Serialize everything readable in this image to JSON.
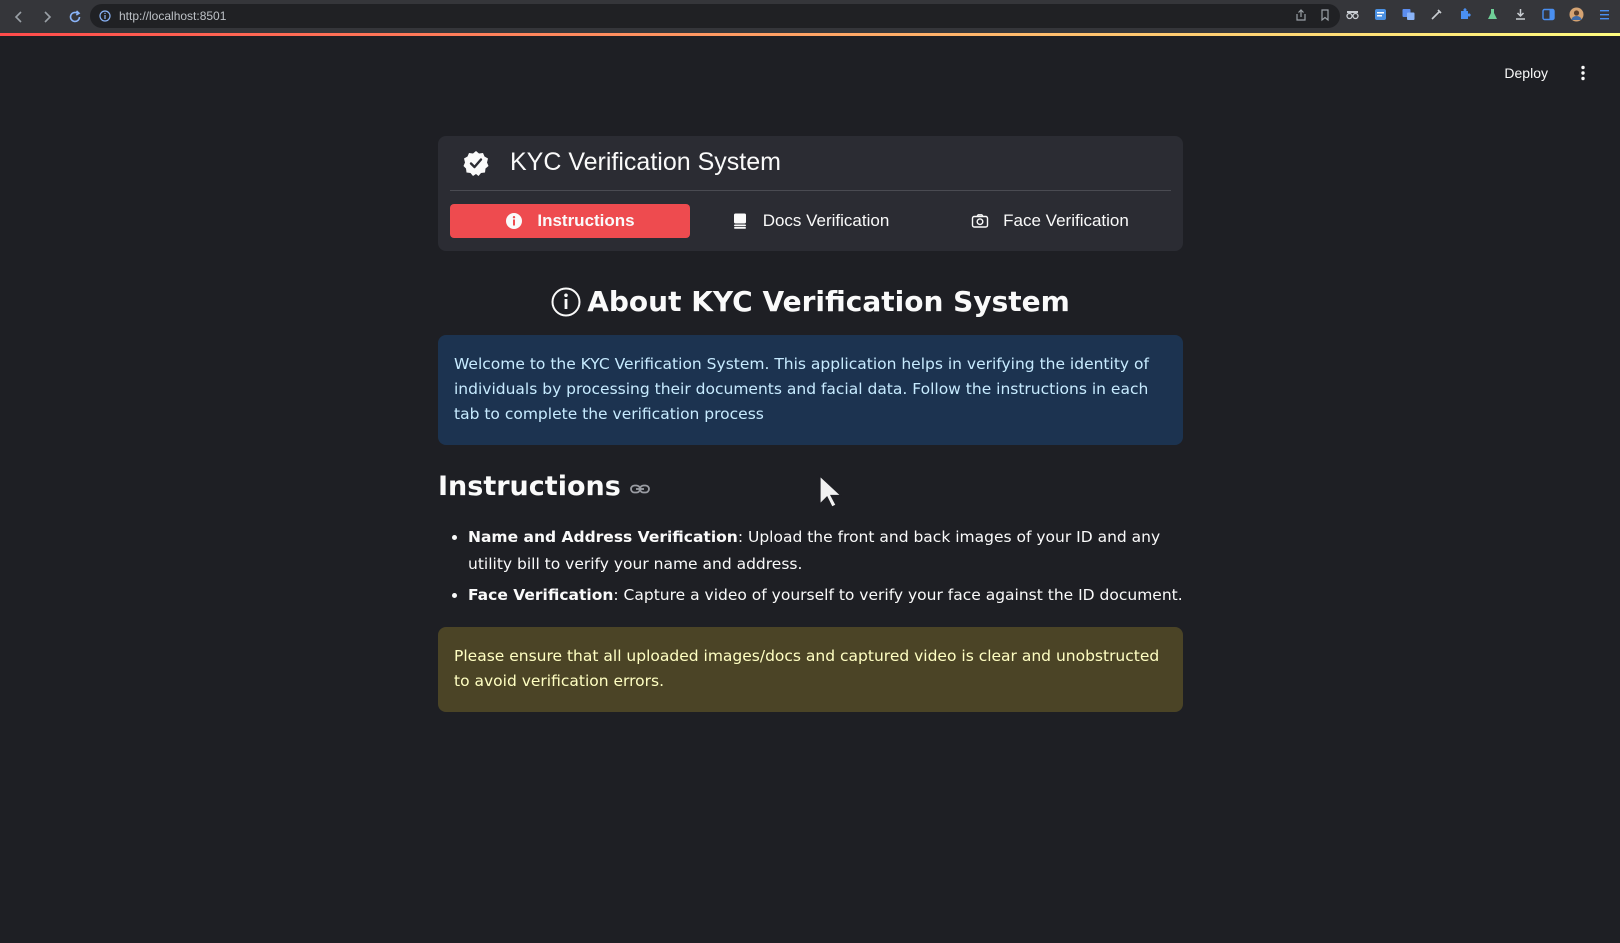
{
  "browser": {
    "url": "http://localhost:8501"
  },
  "header": {
    "deploy_label": "Deploy"
  },
  "nav": {
    "title": "KYC Verification System",
    "tabs": [
      {
        "label": "Instructions",
        "icon": "info-circle-icon",
        "active": true
      },
      {
        "label": "Docs Verification",
        "icon": "document-stack-icon",
        "active": false
      },
      {
        "label": "Face Verification",
        "icon": "camera-icon",
        "active": false
      }
    ],
    "active_color": "#ee4b4f"
  },
  "about": {
    "heading": "About KYC Verification System",
    "info_text": "Welcome to the KYC Verification System. This application helps in verifying the identity of individuals by processing their documents and facial data. Follow the instructions in each tab to complete the verification process"
  },
  "instructions": {
    "heading": "Instructions",
    "items": [
      {
        "title": "Name and Address Verification",
        "text": ": Upload the front and back images of your ID and any utility bill to verify your name and address."
      },
      {
        "title": "Face Verification",
        "text": ": Capture a video of yourself to verify your face against the ID document."
      }
    ],
    "warning": "Please ensure that all uploaded images/docs and captured video is clear and unobstructed to avoid verification errors."
  },
  "colors": {
    "background": "#1e1f24",
    "info_bg": "#1c3350",
    "warning_bg": "#4b4426",
    "accent": "#ff4b4b"
  }
}
